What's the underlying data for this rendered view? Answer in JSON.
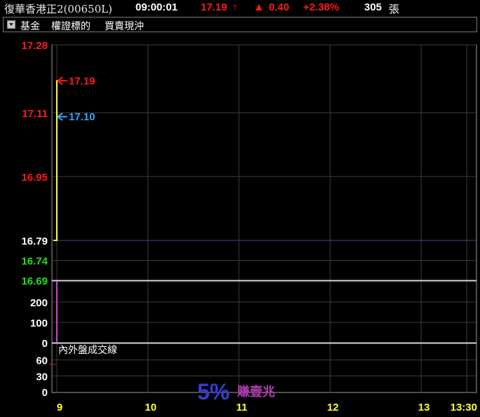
{
  "header": {
    "stock_name": "復華香港正2(00650L)",
    "time": "09:00:01",
    "price": "17.19",
    "price_arrow": "↑",
    "change_arrow": "▲",
    "change": "0.40",
    "change_pct": "+2.38%",
    "volume": "305",
    "volume_unit": "張"
  },
  "toolbar": {
    "dropdown_icon": "chevron-down-icon",
    "items": [
      "基金",
      "權證標的",
      "買賣現沖"
    ]
  },
  "colors": {
    "up": "#ff1a1a",
    "down": "#20e020",
    "neutral": "#ffffff",
    "price_line": "#ffff33",
    "avg_marker": "#33a8ff",
    "volume_bar": "#cc44cc",
    "time_label": "#ffff33",
    "grid": "#3c3c3c"
  },
  "chart_data": {
    "type": "line",
    "x_ticks": [
      "9",
      "10",
      "11",
      "12",
      "13",
      "13:30"
    ],
    "price_axis_labels": [
      {
        "value": "17.28",
        "color": "up"
      },
      {
        "value": "17.11",
        "color": "up"
      },
      {
        "value": "16.95",
        "color": "up"
      },
      {
        "value": "16.79",
        "color": "neutral"
      },
      {
        "value": "16.74",
        "color": "down"
      },
      {
        "value": "16.69",
        "color": "down"
      }
    ],
    "price_ylim": [
      16.69,
      17.28
    ],
    "reference_price": 16.79,
    "price_series": {
      "x": [
        "09:00",
        "09:00",
        "09:00",
        "09:01"
      ],
      "y": [
        16.79,
        16.79,
        17.19,
        17.19
      ]
    },
    "last_price_marker": {
      "label": "17.19",
      "value": 17.19
    },
    "avg_price_marker": {
      "label": "17.10",
      "value": 17.1
    },
    "volume_axis_labels": [
      "200",
      "100",
      "0"
    ],
    "volume_ylim": [
      0,
      300
    ],
    "volume_bars": [
      {
        "x": "09:00",
        "value": 305
      }
    ],
    "indicator_title": "內外盤成交線",
    "indicator_axis_labels": [
      "60",
      "30",
      "0"
    ],
    "indicator_ylim": [
      0,
      90
    ],
    "indicator_series": {
      "x": [
        "09:00"
      ],
      "y": [
        52
      ]
    }
  },
  "watermark": {
    "big": "5%",
    "small": "賺壹兆"
  }
}
